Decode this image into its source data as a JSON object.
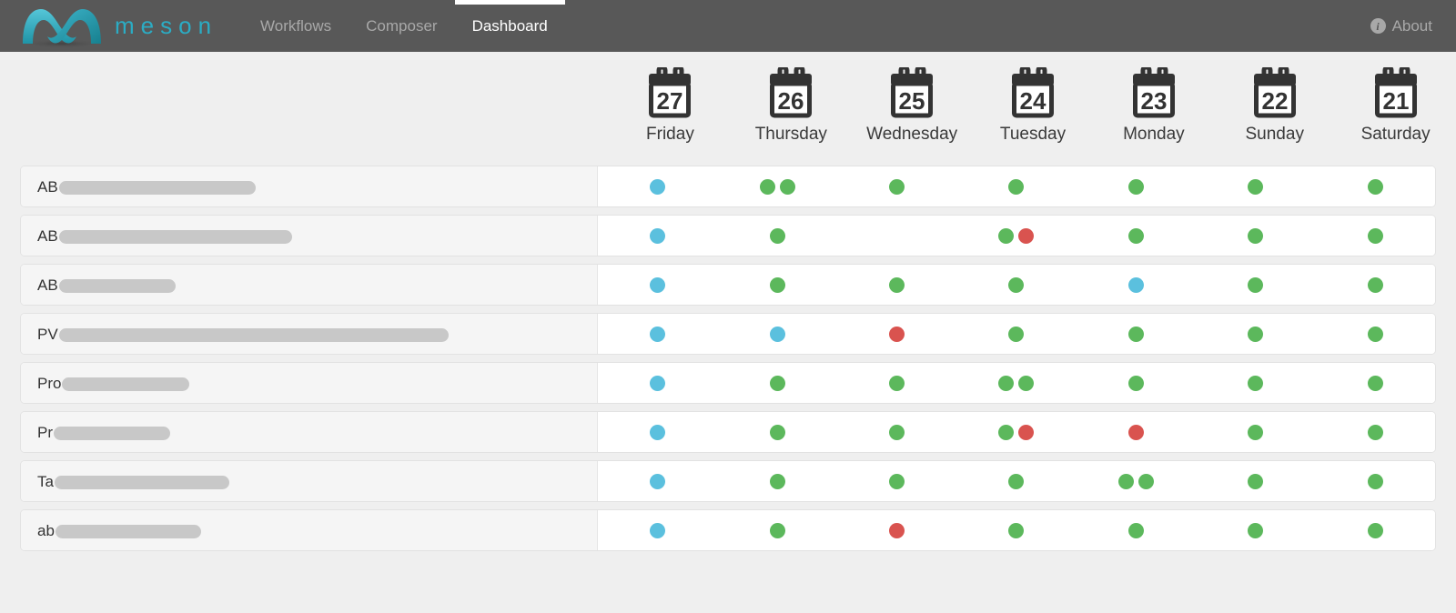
{
  "navbar": {
    "brand_name": "meson",
    "brand_color": "#2bacc4",
    "items": [
      {
        "label": "Workflows",
        "active": false
      },
      {
        "label": "Composer",
        "active": false
      },
      {
        "label": "Dashboard",
        "active": true
      }
    ],
    "about_label": "About",
    "about_icon": "info-circle-icon",
    "background_color": "#585858"
  },
  "columns": [
    {
      "date": "27",
      "day": "Friday"
    },
    {
      "date": "26",
      "day": "Thursday"
    },
    {
      "date": "25",
      "day": "Wednesday"
    },
    {
      "date": "24",
      "day": "Tuesday"
    },
    {
      "date": "23",
      "day": "Monday"
    },
    {
      "date": "22",
      "day": "Sunday"
    },
    {
      "date": "21",
      "day": "Saturday"
    }
  ],
  "status_colors": {
    "blue": "#5bc0de",
    "green": "#5cb85c",
    "red": "#d9534f"
  },
  "rows": [
    {
      "label_prefix": "AB",
      "redacted_width": 216,
      "cells": [
        [
          "blue"
        ],
        [
          "green",
          "green"
        ],
        [
          "green"
        ],
        [
          "green"
        ],
        [
          "green"
        ],
        [
          "green"
        ],
        [
          "green"
        ]
      ]
    },
    {
      "label_prefix": "AB",
      "redacted_width": 256,
      "cells": [
        [
          "blue"
        ],
        [
          "green"
        ],
        [],
        [
          "green",
          "red"
        ],
        [
          "green"
        ],
        [
          "green"
        ],
        [
          "green"
        ]
      ]
    },
    {
      "label_prefix": "AB",
      "redacted_width": 128,
      "cells": [
        [
          "blue"
        ],
        [
          "green"
        ],
        [
          "green"
        ],
        [
          "green"
        ],
        [
          "blue"
        ],
        [
          "green"
        ],
        [
          "green"
        ]
      ]
    },
    {
      "label_prefix": "PV",
      "redacted_width": 428,
      "cells": [
        [
          "blue"
        ],
        [
          "blue"
        ],
        [
          "red"
        ],
        [
          "green"
        ],
        [
          "green"
        ],
        [
          "green"
        ],
        [
          "green"
        ]
      ]
    },
    {
      "label_prefix": "Pro",
      "redacted_width": 140,
      "cells": [
        [
          "blue"
        ],
        [
          "green"
        ],
        [
          "green"
        ],
        [
          "green",
          "green"
        ],
        [
          "green"
        ],
        [
          "green"
        ],
        [
          "green"
        ]
      ]
    },
    {
      "label_prefix": "Pr",
      "redacted_width": 128,
      "cells": [
        [
          "blue"
        ],
        [
          "green"
        ],
        [
          "green"
        ],
        [
          "green",
          "red"
        ],
        [
          "red"
        ],
        [
          "green"
        ],
        [
          "green"
        ]
      ]
    },
    {
      "label_prefix": "Ta",
      "redacted_width": 192,
      "cells": [
        [
          "blue"
        ],
        [
          "green"
        ],
        [
          "green"
        ],
        [
          "green"
        ],
        [
          "green",
          "green"
        ],
        [
          "green"
        ],
        [
          "green"
        ]
      ]
    },
    {
      "label_prefix": "ab",
      "redacted_width": 160,
      "cells": [
        [
          "blue"
        ],
        [
          "green"
        ],
        [
          "red"
        ],
        [
          "green"
        ],
        [
          "green"
        ],
        [
          "green"
        ],
        [
          "green"
        ]
      ]
    }
  ]
}
